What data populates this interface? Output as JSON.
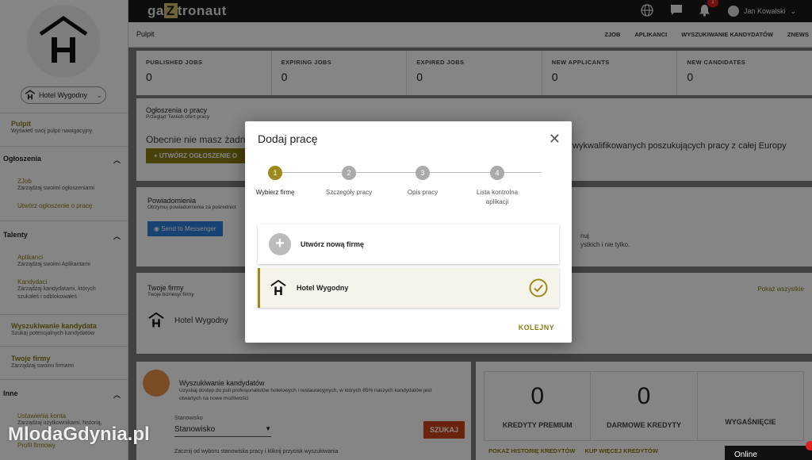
{
  "sidebar": {
    "company_name": "Hotel Wygodny",
    "pulpit": {
      "title": "Pulpit",
      "sub": "Wyświetl swój pulpit nawigacyjny"
    },
    "ogloszenia": {
      "title": "Ogłoszenia",
      "items": [
        {
          "label": "ZJob",
          "sub": "Zarządzaj swoimi ogłoszeniami"
        },
        {
          "label": "Utwórz ogłoszenie o pracę",
          "sub": ""
        }
      ]
    },
    "talenty": {
      "title": "Talenty",
      "items": [
        {
          "label": "Aplikanci",
          "sub": "Zarządzaj swoimi Aplikantami"
        },
        {
          "label": "Kandydaci",
          "sub": "Zarządzaj kandydatami, których szukałeś i odblokowałeś"
        }
      ]
    },
    "wyszukiwanie": {
      "title": "Wyszukiwanie kandydata",
      "sub": "Szukaj potencjalnych kandydatów"
    },
    "firmy": {
      "title": "Twoje firmy",
      "sub": "Zarządzaj swoimi firmami"
    },
    "inne": {
      "title": "Inne",
      "items": [
        {
          "label": "Ustawienia konta",
          "sub": "Zarządzaj użytkownikami, historią,"
        },
        {
          "label": "Profil firmowy",
          "sub": ""
        }
      ]
    }
  },
  "topbar": {
    "brand_pre": "ga",
    "brand_z": "Z",
    "brand_post": "tronaut",
    "notification_count": "1",
    "user_name": "Jan Kowalski"
  },
  "subbar": {
    "title": "Pulpit",
    "nav": [
      "ZJOB",
      "APLIKANCI",
      "WYSZUKIWANIE KANDYDATÓW",
      "ZNEWS"
    ]
  },
  "stats": [
    {
      "label": "PUBLISHED JOBS",
      "value": "0"
    },
    {
      "label": "EXPIRING JOBS",
      "value": "0"
    },
    {
      "label": "EXPIRED JOBS",
      "value": "0"
    },
    {
      "label": "NEW APPLICANTS",
      "value": "0"
    },
    {
      "label": "NEW CANDIDATES",
      "value": "0"
    }
  ],
  "jobs_card": {
    "title": "Ogłoszenia o pracy",
    "sub": "Przegląd Twoich ofert pracy",
    "empty_text": "Obecnie nie masz żadnych",
    "empty_text_right": "wykwalifikowanych poszukujących pracy z całej Europy",
    "create_button": "+ UTWÓRZ OGŁOSZENIE O"
  },
  "notifications_card": {
    "title": "Powiadomienia",
    "sub": "Otrzymuj powiadomienia za pośrednict",
    "messenger_button": "Send to Messenger",
    "right_text_1": "nuj",
    "right_text_2": "ystkich i nie tylko."
  },
  "companies_card": {
    "title": "Twoje firmy",
    "sub": "Twoje biznesy/ firmy",
    "show_all": "Pokaż wszystkie",
    "company": "Hotel Wygodny"
  },
  "search_card": {
    "title": "Wyszukiwanie kandydatów",
    "desc": "Uzyskaj dostęp do puli profesjonalistów hotelowych i restauracyjnych, w których 85% naszych kandydatów jest otwartych na nowe możliwości",
    "field_label": "Stanowisko",
    "field_value": "Stanowisko",
    "button": "SZUKAJ",
    "hint": "Zacznij od wyboru stanowiska pracy i kliknij przycisk wyszukiwania"
  },
  "credits_card": {
    "boxes": [
      {
        "num": "0",
        "label": "KREDYTY PREMIUM"
      },
      {
        "num": "0",
        "label": "DARMOWE KREDYTY"
      },
      {
        "num": "",
        "label": "WYGAŚNIĘCIE"
      }
    ],
    "history_link": "POKAŻ HISTORIĘ KREDYTÓW",
    "buy_link": "KUP WIĘCEJ KREDYTÓW"
  },
  "modal": {
    "title": "Dodaj pracę",
    "steps": [
      {
        "num": "1",
        "label": "Wybierz firmę"
      },
      {
        "num": "2",
        "label": "Szczegóły pracy"
      },
      {
        "num": "3",
        "label": "Opis pracy"
      },
      {
        "num": "4",
        "label": "Lista kontrolna aplikacji"
      }
    ],
    "new_company": "Utwórz nową firmę",
    "selected_company": "Hotel Wygodny",
    "next": "KOLEJNY"
  },
  "watermark": "MlodaGdynia.pl",
  "chat_status": "Online",
  "colors": {
    "gold": "#8b7d14",
    "accent_step": "#9c8b1c",
    "topbar": "#1a1a1a",
    "danger": "#d22222"
  }
}
